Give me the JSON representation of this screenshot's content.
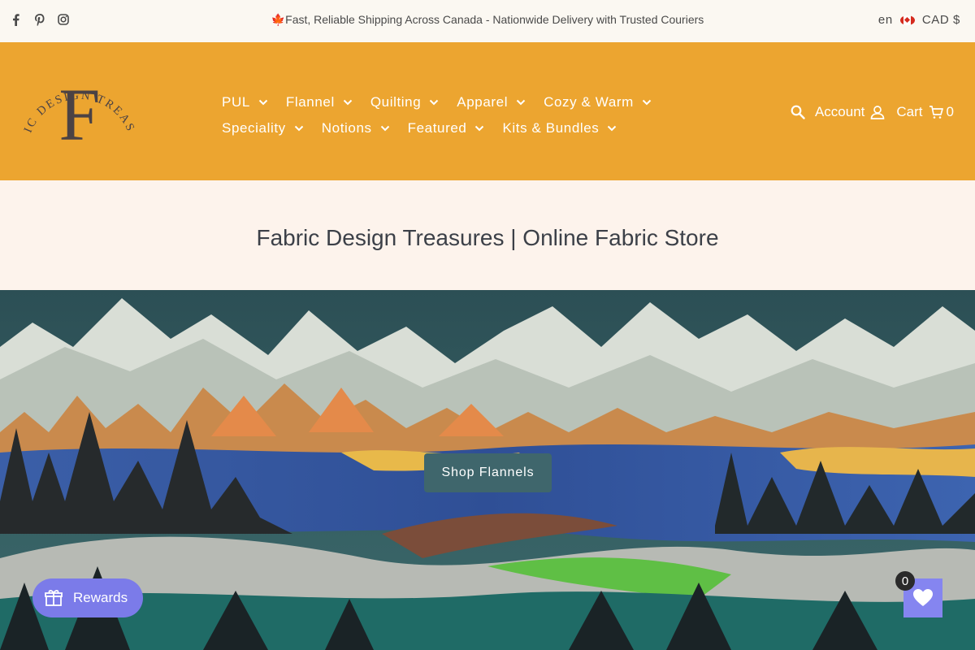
{
  "announcement": {
    "icon": "maple-leaf-icon",
    "text": "Fast, Reliable Shipping Across Canada - Nationwide Delivery with Trusted Couriers"
  },
  "social": [
    "facebook-icon",
    "pinterest-icon",
    "instagram-icon"
  ],
  "locale": {
    "language": "en",
    "currency": "CAD $"
  },
  "brand": {
    "logo_text": "FABRIC DESIGN TREASURES",
    "monogram": "F"
  },
  "nav": {
    "row1": [
      "PUL",
      "Flannel",
      "Quilting",
      "Apparel",
      "Cozy & Warm"
    ],
    "row2": [
      "Speciality",
      "Notions",
      "Featured",
      "Kits & Bundles"
    ]
  },
  "utils": {
    "account_label": "Account",
    "cart_label": "Cart",
    "cart_count": "0"
  },
  "page": {
    "title": "Fabric Design Treasures | Online Fabric Store"
  },
  "hero": {
    "cta_label": "Shop Flannels"
  },
  "widgets": {
    "rewards_label": "Rewards",
    "wishlist_count": "0"
  },
  "colors": {
    "header_bg": "#eca530",
    "cta_bg": "#3f666c",
    "rewards_bg": "#7b7be9",
    "page_bg": "#fdf3ec"
  }
}
